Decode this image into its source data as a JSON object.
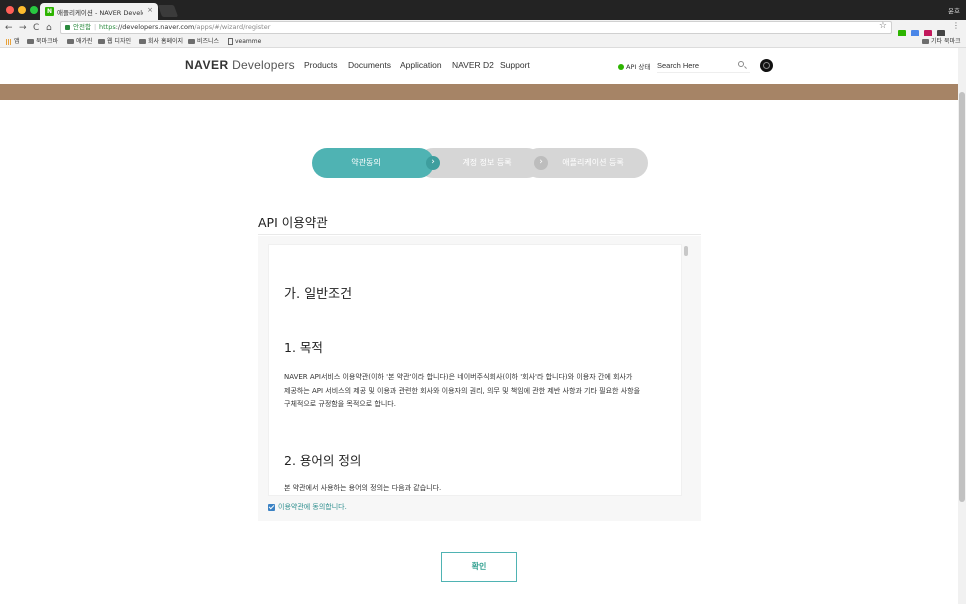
{
  "browser": {
    "tab_title": "애플리케이션 - NAVER Developers",
    "tab_favicon": "N",
    "tab_close": "×",
    "profile_name": "윤호",
    "secure_label": "안전함",
    "url_scheme": "https",
    "url_host": "://developers.naver.com",
    "url_path": "/apps/#/wizard/register",
    "nav": {
      "back": "←",
      "forward": "→",
      "reload": "C",
      "home": "⌂"
    },
    "star": "☆",
    "menu": "⋮",
    "bookmarks": [
      {
        "label": "앱",
        "icon": "apps-icon"
      },
      {
        "label": "북마크바",
        "icon": "folder-icon"
      },
      {
        "label": "애가린",
        "icon": "folder-icon"
      },
      {
        "label": "웹 디자인",
        "icon": "folder-icon"
      },
      {
        "label": "회사 홈페이지",
        "icon": "folder-icon"
      },
      {
        "label": "비즈니스",
        "icon": "folder-icon"
      },
      {
        "label": "veamme",
        "icon": "page-icon"
      }
    ],
    "other_bookmarks": "기타 북마크",
    "extension_colors": [
      "#2db400",
      "#4a86e8",
      "#c2185b",
      "#444444"
    ]
  },
  "header": {
    "logo_brand": "NAVER",
    "logo_sub": " Developers",
    "nav_items": [
      "Products",
      "Documents",
      "Application",
      "NAVER D2",
      "Support"
    ],
    "api_status": "API 상태",
    "search_placeholder": "Search Here"
  },
  "wizard": {
    "steps": [
      "약관동의",
      "계정 정보 등록",
      "애플리케이션 등록"
    ],
    "active_step": 1,
    "arrow": "›",
    "colors": {
      "active": "#4fb3b3",
      "inactive": "#d6d6d6"
    }
  },
  "terms": {
    "section_title": "API 이용약관",
    "h1": "가. 일반조건",
    "h2a": "1. 목적",
    "para_lines": [
      "NAVER API서비스 이용약관(이하 '본 약관'이라 합니다)은 네이버주식회사(이하 '회사'라 합니다)와 이용자 간에 회사가",
      "제공하는 API 서비스의 제공 및 이용과 관련한 회사와 이용자의 권리, 의무 및 책임에 관한 제반 사항과 기타 필요한 사항을",
      "구체적으로 규정함을 목적으로 합니다."
    ],
    "h2b": "2. 용어의 정의",
    "para2": "본 약관에서 사용하는 용어의 정의는 다음과 같습니다.",
    "agree_label": "이용약관에 동의합니다.",
    "agree_checked": true
  },
  "confirm_label": "확인"
}
